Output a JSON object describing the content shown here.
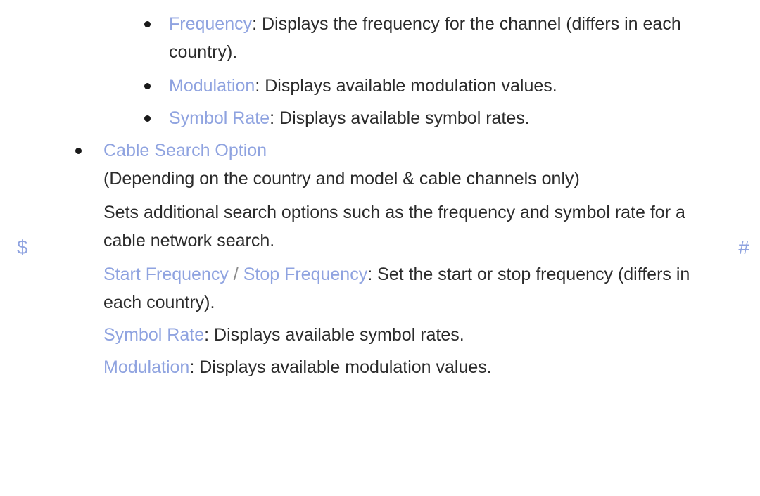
{
  "markers": {
    "left": "$",
    "right": "#"
  },
  "colors": {
    "accent": "#8fa3e0",
    "body_text": "#2b2b2b",
    "background": "#ffffff",
    "bullet": "#1a1a1a"
  },
  "blocks": [
    {
      "id": "frequency-item",
      "term": "Frequency",
      "rest": ": Displays the frequency for the channel (differs in each",
      "continuation": "country)."
    },
    {
      "id": "modulation-item",
      "term": "Modulation",
      "rest": ": Displays available modulation values."
    },
    {
      "id": "symbol-rate-item",
      "term": "Symbol Rate",
      "rest": ": Displays available symbol rates."
    }
  ],
  "cable_search_option": {
    "heading": "Cable Search Option",
    "note": "(Depending on the country and model & cable channels only)",
    "description_line1": "Sets additional search options such as the frequency and symbol rate for a",
    "description_line2": "cable network search.",
    "items": [
      {
        "id": "start-stop-frequency-item",
        "term_a": "Start Frequency",
        "separator": " / ",
        "term_b": "Stop Frequency",
        "rest": ": Set the start or stop frequency (differs in",
        "continuation": "each country)."
      },
      {
        "id": "symbol-rate-sub-item",
        "term": "Symbol Rate",
        "rest": ": Displays available symbol rates."
      },
      {
        "id": "modulation-sub-item",
        "term": "Modulation",
        "rest": ": Displays available modulation values."
      }
    ]
  }
}
